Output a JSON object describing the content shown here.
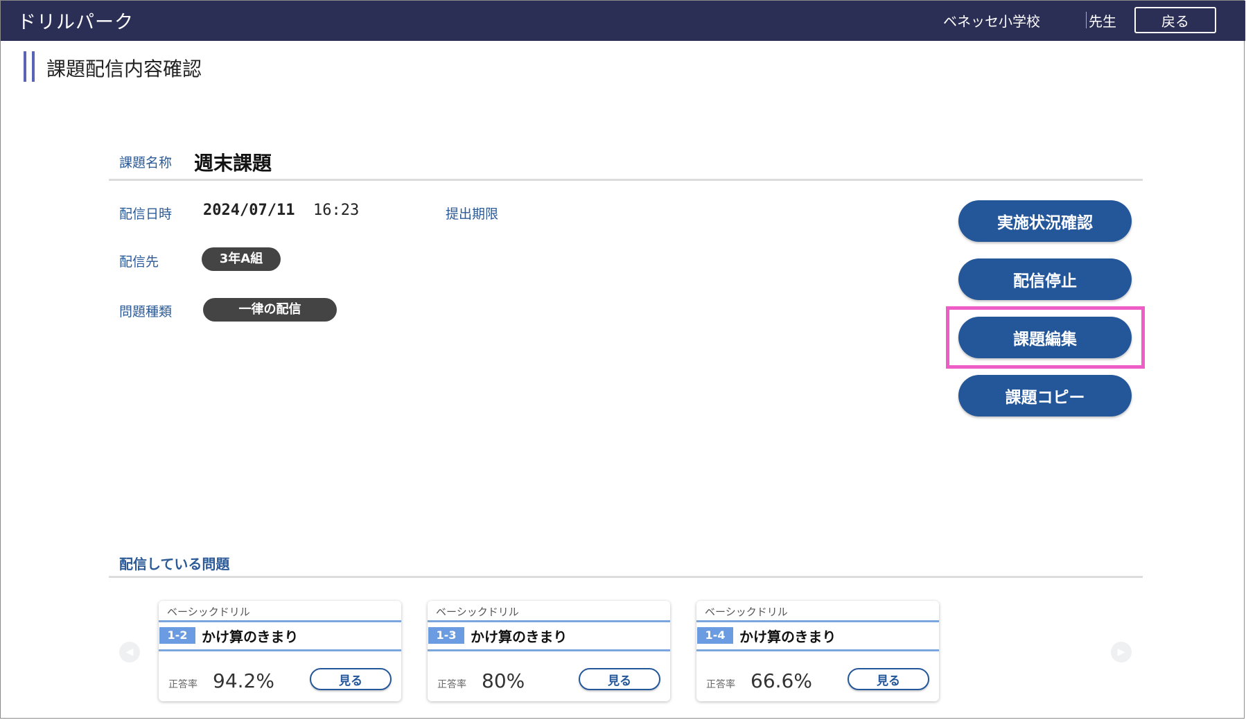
{
  "header": {
    "app_title": "ドリルパーク",
    "school": "ベネッセ小学校",
    "teacher": "先生",
    "back_label": "戻る"
  },
  "page_title": "課題配信内容確認",
  "task": {
    "name_label": "課題名称",
    "name": "週末課題",
    "date_label": "配信日時",
    "date": "2024/07/11",
    "time": "16:23",
    "deadline_label": "提出期限",
    "dest_label": "配信先",
    "dest": "3年A組",
    "type_label": "問題種類",
    "type": "一律の配信"
  },
  "actions": {
    "status_check": "実施状況確認",
    "stop": "配信停止",
    "edit": "課題編集",
    "copy": "課題コピー"
  },
  "problems": {
    "section_title": "配信している問題",
    "cards": [
      {
        "category": "ベーシックドリル",
        "num": "1-2",
        "title": "かけ算のきまり",
        "rate_label": "正答率",
        "rate": "94.2%",
        "view_label": "見る"
      },
      {
        "category": "ベーシックドリル",
        "num": "1-3",
        "title": "かけ算のきまり",
        "rate_label": "正答率",
        "rate": "80%",
        "view_label": "見る"
      },
      {
        "category": "ベーシックドリル",
        "num": "1-4",
        "title": "かけ算のきまり",
        "rate_label": "正答率",
        "rate": "66.6%",
        "view_label": "見る"
      }
    ]
  },
  "colors": {
    "header_bg": "#2c2f55",
    "accent_blue": "#24569a",
    "label_blue": "#2c5a97",
    "highlight_pink": "#ee5cc6"
  },
  "icons": {
    "prev": "chevron-left-icon",
    "next": "chevron-right-icon"
  }
}
